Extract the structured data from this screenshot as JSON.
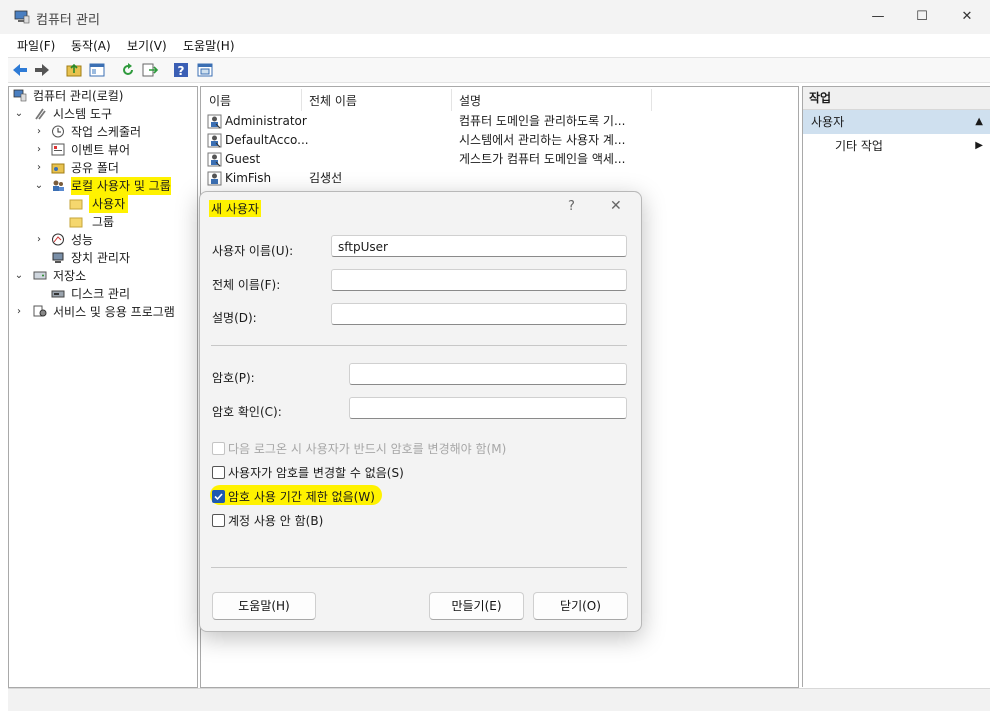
{
  "window": {
    "title": "컴퓨터 관리"
  },
  "menu": [
    "파일(F)",
    "동작(A)",
    "보기(V)",
    "도움말(H)"
  ],
  "toolbar": {
    "icons": [
      "back-icon",
      "forward-icon",
      "up-folder-icon",
      "show-hide-tree-icon",
      "refresh-icon",
      "export-icon",
      "help-icon",
      "properties-icon"
    ]
  },
  "tree": {
    "root": "컴퓨터 관리(로컬)",
    "system_tools": "시스템 도구",
    "task_scheduler": "작업 스케줄러",
    "event_viewer": "이벤트 뷰어",
    "shared_folders": "공유 폴더",
    "local_users_groups": "로컬 사용자 및 그룹",
    "users": "사용자",
    "groups": "그룹",
    "performance": "성능",
    "device_manager": "장치 관리자",
    "storage": "저장소",
    "disk_management": "디스크 관리",
    "services_apps": "서비스 및 응용 프로그램"
  },
  "list": {
    "headers": {
      "name": "이름",
      "fullname": "전체 이름",
      "description": "설명"
    },
    "rows": [
      {
        "name": "Administrator",
        "fullname": "",
        "description": "컴퓨터 도메인을 관리하도록 기..."
      },
      {
        "name": "DefaultAcco...",
        "fullname": "",
        "description": "시스템에서 관리하는 사용자 계..."
      },
      {
        "name": "Guest",
        "fullname": "",
        "description": "게스트가 컴퓨터 도메인을 액세..."
      },
      {
        "name": "KimFish",
        "fullname": "김생선",
        "description": ""
      }
    ]
  },
  "actions": {
    "header": "작업",
    "section": "사용자",
    "more": "기타 작업"
  },
  "dialog": {
    "title": "새 사용자",
    "help_glyph": "?",
    "username_label": "사용자 이름(U):",
    "username_value": "sftpUser",
    "fullname_label": "전체 이름(F):",
    "fullname_value": "",
    "description_label": "설명(D):",
    "description_value": "",
    "password_label": "암호(P):",
    "confirm_label": "암호 확인(C):",
    "checkboxes": [
      {
        "label": "다음 로그온 시 사용자가 반드시 암호를 변경해야 함(M)",
        "checked": false,
        "disabled": true
      },
      {
        "label": "사용자가 암호를 변경할 수 없음(S)",
        "checked": false,
        "disabled": false
      },
      {
        "label": "암호 사용 기간 제한 없음(W)",
        "checked": true,
        "disabled": false
      },
      {
        "label": "계정 사용 안 함(B)",
        "checked": false,
        "disabled": false
      }
    ],
    "buttons": {
      "help": "도움말(H)",
      "create": "만들기(E)",
      "close": "닫기(O)"
    }
  },
  "colors": {
    "highlight": "#fff200",
    "accent": "#1f5ab0",
    "action_section_bg": "#cfe0ef"
  }
}
